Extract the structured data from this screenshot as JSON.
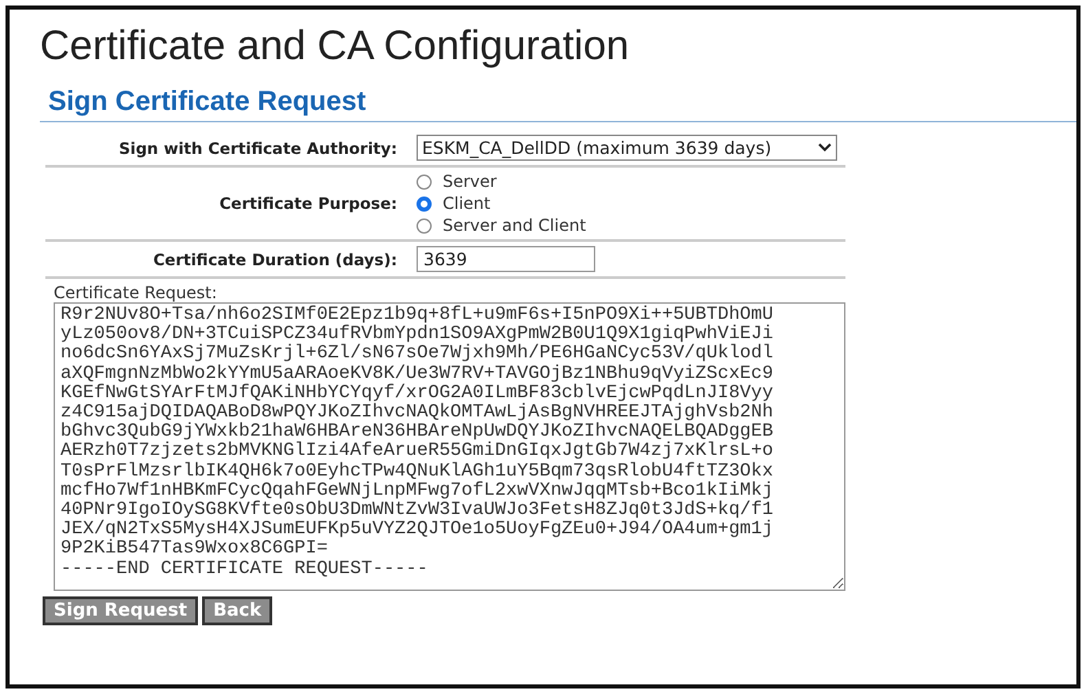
{
  "page_title": "Certificate and CA Configuration",
  "section_title": "Sign Certificate Request",
  "authority": {
    "label": "Sign with Certificate Authority:",
    "value": "ESKM_CA_DellDD (maximum 3639 days)"
  },
  "purpose": {
    "label": "Certificate Purpose:",
    "options": [
      {
        "label": "Server",
        "selected": false
      },
      {
        "label": "Client",
        "selected": true
      },
      {
        "label": "Server and Client",
        "selected": false
      }
    ]
  },
  "duration": {
    "label": "Certificate Duration (days):",
    "value": "3639"
  },
  "request": {
    "label": "Certificate Request:",
    "lines": [
      "R9r2NUv8O+Tsa/nh6o2SIMf0E2Epz1b9q+8fL+u9mF6s+I5nPO9Xi++5UBTDhOmU",
      "yLz050ov8/DN+3TCuiSPCZ34ufRVbmYpdn1SO9AXgPmW2B0U1Q9X1giqPwhViEJi",
      "no6dcSn6YAxSj7MuZsKrjl+6Zl/sN67sOe7Wjxh9Mh/PE6HGaNCyc53V/qUklodl",
      "aXQFmgnNzMbWo2kYYmU5aARAoeKV8K/Ue3W7RV+TAVGOjBz1NBhu9qVyiZScxEc9",
      "KGEfNwGtSYArFtMJfQAKiNHbYCYqyf/xrOG2A0ILmBF83cblvEjcwPqdLnJI8Vyy",
      "z4C915ajDQIDAQABoD8wPQYJKoZIhvcNAQkOMTAwLjAsBgNVHREEJTAjghVsb2Nh",
      "bGhvc3QubG9jYWxkb21haW6HBAreN36HBAreNpUwDQYJKoZIhvcNAQELBQADggEB",
      "AERzh0T7zjzets2bMVKNGlIzi4AfeArueR55GmiDnGIqxJgtGb7W4zj7xKlrsL+o",
      "T0sPrFlMzsrlbIK4QH6k7o0EyhcTPw4QNuKlAGh1uY5Bqm73qsRlobU4ftTZ3Okx",
      "mcfHo7Wf1nHBKmFCycQqahFGeWNjLnpMFwg7ofL2xwVXnwJqqMTsb+Bco1kIiMkj",
      "40PNr9IgoIOySG8KVfte0sObU3DmWNtZvW3IvaUWJo3FetsH8ZJq0t3JdS+kq/f1",
      "JEX/qN2TxS5MysH4XJSumEUFKp5uVYZ2QJTOe1o5UoyFgZEu0+J94/OA4um+gm1j",
      "9P2KiB547Tas9Wxox8C6GPI=",
      "-----END CERTIFICATE REQUEST-----"
    ]
  },
  "buttons": [
    "Sign Request",
    "Back"
  ]
}
